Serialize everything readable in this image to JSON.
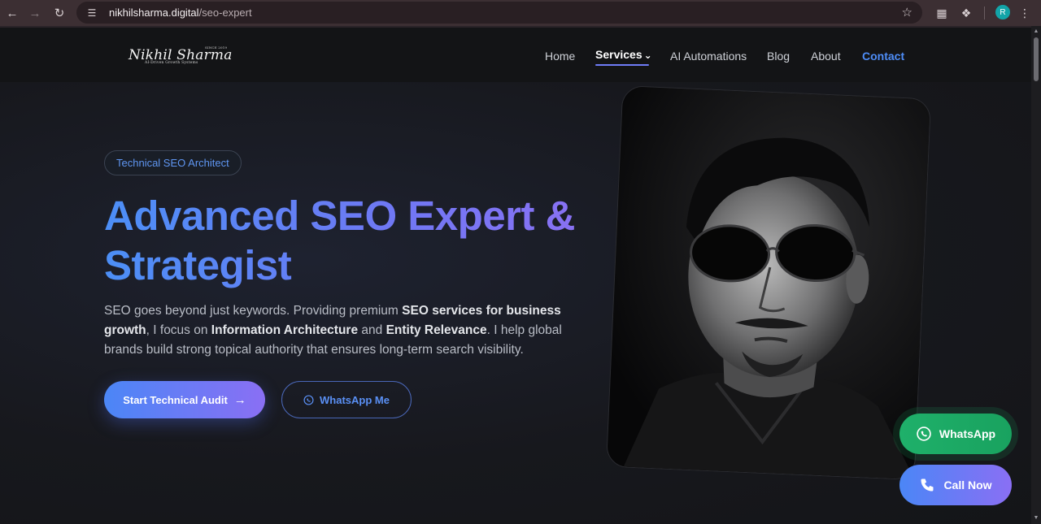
{
  "browser": {
    "url_host": "nikhilsharma.digital",
    "url_path": "/seo-expert",
    "profile_initial": "R"
  },
  "logo": {
    "name": "Nikhil Sharma",
    "since": "SINCE 2019",
    "tagline": "AI-Driven Growth Systems"
  },
  "nav": {
    "home": "Home",
    "services": "Services",
    "ai_automations": "AI Automations",
    "blog": "Blog",
    "about": "About",
    "contact": "Contact"
  },
  "hero": {
    "badge": "Technical SEO Architect",
    "headline_line1": "Advanced SEO Expert &",
    "headline_line2": "Strategist",
    "desc_1": "SEO goes beyond just keywords. Providing premium ",
    "desc_b1": "SEO services for business growth",
    "desc_2": ", I focus on ",
    "desc_b2": "Information Architecture",
    "desc_3": " and ",
    "desc_b3": "Entity Relevance",
    "desc_4": ". I help global brands build strong topical authority that ensures long-term search visibility.",
    "cta_primary": "Start Technical Audit",
    "cta_secondary": "WhatsApp Me"
  },
  "floating": {
    "whatsapp": "WhatsApp",
    "call": "Call Now"
  },
  "colors": {
    "accent_blue": "#4c8ff6",
    "accent_purple": "#8f6ff3",
    "whatsapp_green": "#1fb06a",
    "background": "#16171b"
  }
}
